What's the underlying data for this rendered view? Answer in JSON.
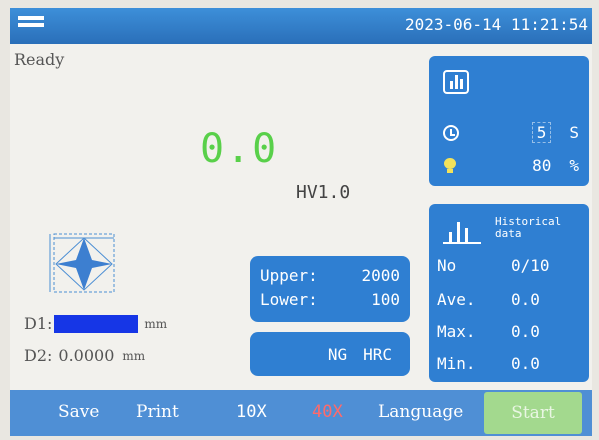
{
  "header": {
    "menu_icon": "hamburger-menu-icon",
    "datetime": "2023-06-14 11:21:54"
  },
  "main": {
    "status": "Ready",
    "reading": "0.0",
    "scale": "HV1.0",
    "d1_label": "D1:",
    "d1_unit": "mm",
    "d2_label": "D2:",
    "d2_value": "0.0000",
    "d2_unit": "mm"
  },
  "limits": {
    "upper_label": "Upper:",
    "upper_value": "2000",
    "lower_label": "Lower:",
    "lower_value": "100"
  },
  "result": {
    "ng": "NG",
    "unit": "HRC"
  },
  "timer": {
    "dwell_value": "5",
    "dwell_unit": "S",
    "light_value": "80",
    "light_unit": "%"
  },
  "history": {
    "label_line1": "Historical",
    "label_line2": "data",
    "rows": [
      {
        "key": "No",
        "value": "0/10"
      },
      {
        "key": "Ave.",
        "value": "0.0"
      },
      {
        "key": "Max.",
        "value": "0.0"
      },
      {
        "key": "Min.",
        "value": "0.0"
      }
    ]
  },
  "toolbar": {
    "save": "Save",
    "print": "Print",
    "x10": "10X",
    "x40": "40X",
    "language": "Language",
    "start": "Start"
  },
  "colors": {
    "panel_blue": "#2f7fd2",
    "reading_green": "#59d04a",
    "active_objective": "#ff6a6a",
    "start_button": "#a3d98e"
  }
}
